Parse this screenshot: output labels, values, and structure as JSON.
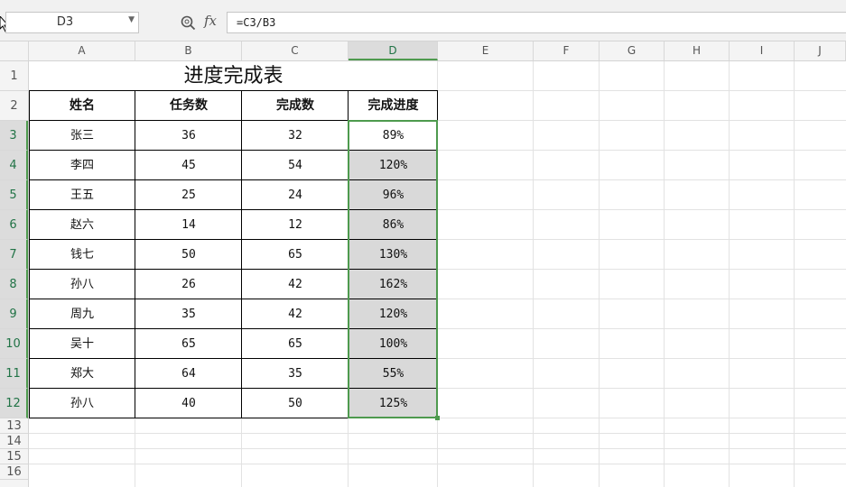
{
  "formula_bar": {
    "name_box": "D3",
    "fx_label": "fx",
    "formula": "=C3/B3"
  },
  "columns": [
    "A",
    "B",
    "C",
    "D",
    "E",
    "F",
    "G",
    "H",
    "I",
    "J"
  ],
  "active_column": "D",
  "rows": [
    "1",
    "2",
    "3",
    "4",
    "5",
    "6",
    "7",
    "8",
    "9",
    "10",
    "11",
    "12",
    "13",
    "14",
    "15",
    "16"
  ],
  "sheet": {
    "title": "进度完成表",
    "headers": [
      "姓名",
      "任务数",
      "完成数",
      "完成进度"
    ],
    "records": [
      {
        "name": "张三",
        "tasks": "36",
        "done": "32",
        "progress": "89%"
      },
      {
        "name": "李四",
        "tasks": "45",
        "done": "54",
        "progress": "120%"
      },
      {
        "name": "王五",
        "tasks": "25",
        "done": "24",
        "progress": "96%"
      },
      {
        "name": "赵六",
        "tasks": "14",
        "done": "12",
        "progress": "86%"
      },
      {
        "name": "钱七",
        "tasks": "50",
        "done": "65",
        "progress": "130%"
      },
      {
        "name": "孙八",
        "tasks": "26",
        "done": "42",
        "progress": "162%"
      },
      {
        "name": "周九",
        "tasks": "35",
        "done": "42",
        "progress": "120%"
      },
      {
        "name": "吴十",
        "tasks": "65",
        "done": "65",
        "progress": "100%"
      },
      {
        "name": "郑大",
        "tasks": "64",
        "done": "35",
        "progress": "55%"
      },
      {
        "name": "孙八",
        "tasks": "40",
        "done": "50",
        "progress": "125%"
      }
    ]
  },
  "colors": {
    "selection": "#4e9a4e",
    "shaded_fill": "#d9d9d9"
  }
}
